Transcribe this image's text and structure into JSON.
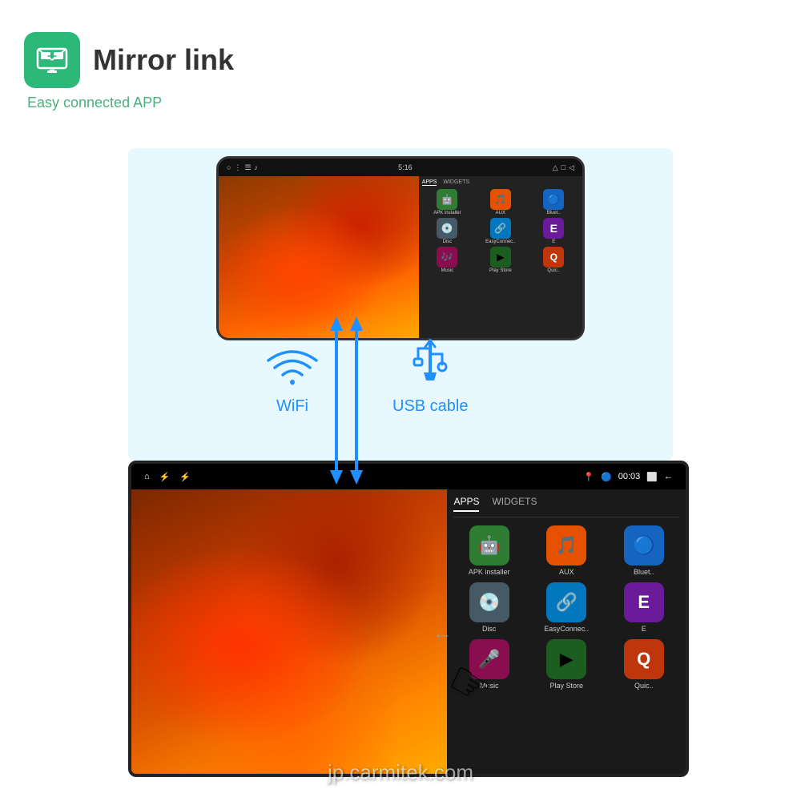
{
  "header": {
    "title": "Mirror link",
    "subtitle": "Easy connected APP",
    "icon_color": "#2db87a"
  },
  "connection": {
    "wifi_label": "WiFi",
    "usb_label": "USB cable"
  },
  "phone": {
    "status_time": "5:16",
    "tabs": [
      "APPS",
      "WIDGETS"
    ],
    "apps": [
      {
        "name": "APK installer",
        "color": "#4caf50",
        "icon": "🤖"
      },
      {
        "name": "AUX",
        "color": "#ff9800",
        "icon": "🎵"
      },
      {
        "name": "Bluet..",
        "color": "#2196f3",
        "icon": "🔵"
      },
      {
        "name": "Disc",
        "color": "#607d8b",
        "icon": "💿"
      },
      {
        "name": "EasyConnec..",
        "color": "#03a9f4",
        "icon": "🔗"
      },
      {
        "name": "E",
        "color": "#9c27b0",
        "icon": "E"
      },
      {
        "name": "Music",
        "color": "#e91e63",
        "icon": "🎶"
      },
      {
        "name": "Play Store",
        "color": "#4caf50",
        "icon": "▶"
      },
      {
        "name": "Quic..",
        "color": "#ff5722",
        "icon": "Q"
      }
    ]
  },
  "car_screen": {
    "status_icons": [
      "🏠",
      "⚡",
      "⚡",
      "📍",
      "🔵",
      "00:03",
      "⬜",
      "←"
    ],
    "tabs": [
      "APPS",
      "WIDGETS"
    ],
    "apps": [
      {
        "name": "APK installer",
        "color": "#4caf50",
        "icon": "🤖"
      },
      {
        "name": "AUX",
        "color": "#ff9800",
        "icon": "🎵"
      },
      {
        "name": "Bluet..",
        "color": "#2196f3",
        "icon": "🔵"
      },
      {
        "name": "Disc",
        "color": "#607d8b",
        "icon": "💿"
      },
      {
        "name": "EasyConnec..",
        "color": "#03a9f4",
        "icon": "🔗"
      },
      {
        "name": "E",
        "color": "#9c27b0",
        "icon": "E"
      },
      {
        "name": "Music",
        "color": "#e91e63",
        "icon": "🎤"
      },
      {
        "name": "Play Store",
        "color": "#4caf50",
        "icon": "▶"
      },
      {
        "name": "Quic..",
        "color": "#ff5722",
        "icon": "Q"
      }
    ]
  },
  "watermark": "jp.carmitek.com"
}
